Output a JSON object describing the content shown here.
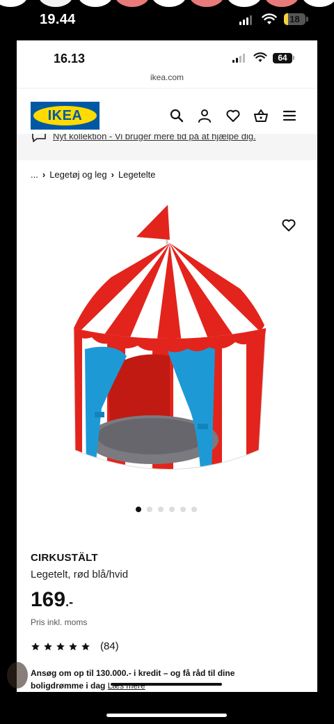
{
  "outer_status": {
    "time": "19.44",
    "battery": "18",
    "battery_level": 0.18,
    "signal_bars": 3
  },
  "inner_status": {
    "time": "16.13",
    "battery": "64",
    "signal_bars": 2
  },
  "browser": {
    "url": "ikea.com"
  },
  "header": {
    "logo_text": "IKEA",
    "icons": [
      "search-icon",
      "profile-icon",
      "heart-icon",
      "basket-icon",
      "menu-icon"
    ]
  },
  "promo": {
    "text": "Nyt kollektion - Vi bruger mere tid på at hjælpe dig."
  },
  "breadcrumb": {
    "ellipsis": "...",
    "items": [
      "Legetøj og leg",
      "Legetelte"
    ]
  },
  "gallery": {
    "image_count": 6,
    "active_index": 0
  },
  "product": {
    "name": "CIRKUSTÄLT",
    "description": "Legetelt, rød blå/hvid",
    "price": "169",
    "price_suffix": ".-",
    "price_note": "Pris inkl. moms",
    "rating_stars": 5,
    "rating_count": "(84)"
  },
  "credit": {
    "text": "Ansøg om op til 130.000.- i kredit – og få råd til dine boligdrømme i dag",
    "link": "Læs mere"
  },
  "colors": {
    "ikea_blue": "#0058a3",
    "ikea_yellow": "#ffdb00",
    "tent_red": "#e3241c",
    "tent_blue": "#1d9ad6"
  }
}
